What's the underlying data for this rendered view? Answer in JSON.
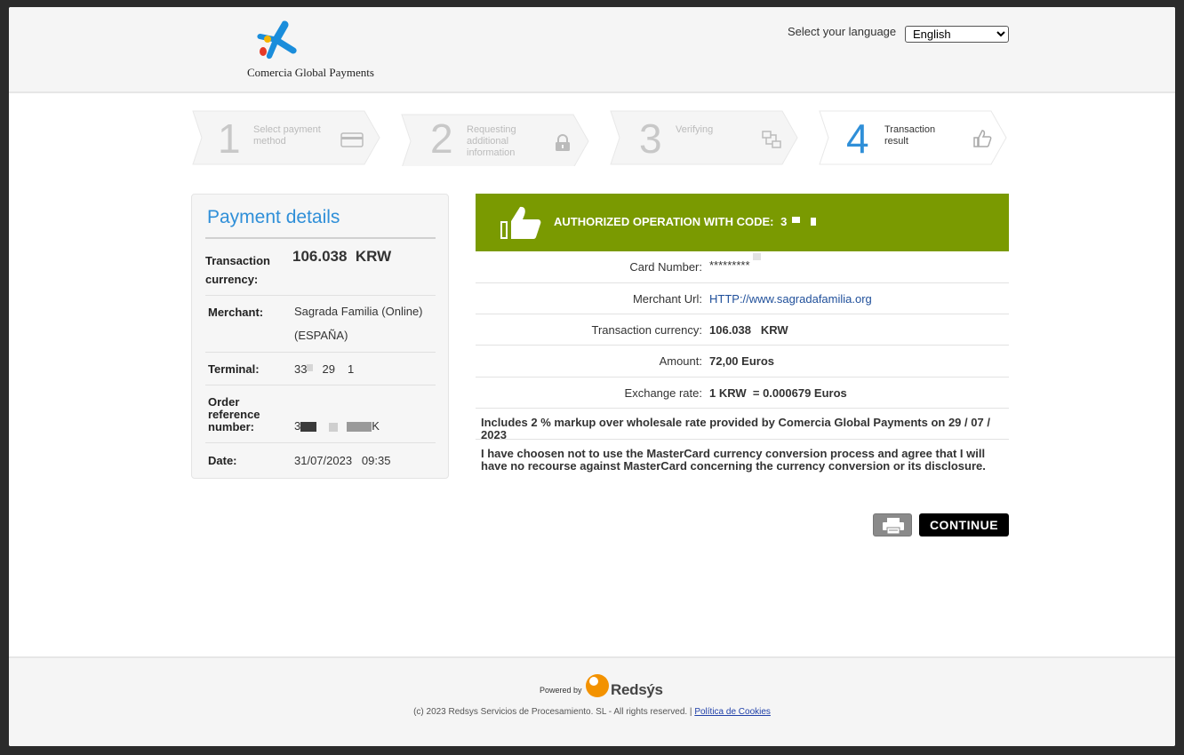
{
  "header": {
    "logo_text": "Comercia Global Payments",
    "language_label": "Select your language",
    "language_selected": "English"
  },
  "steps": [
    {
      "number": "1",
      "label_line1": "Select payment",
      "label_line2": "method",
      "label_line3": "",
      "icon": "credit-card-icon",
      "active": false
    },
    {
      "number": "2",
      "label_line1": "Requesting",
      "label_line2": "additional",
      "label_line3": "information",
      "icon": "lock-icon",
      "active": false
    },
    {
      "number": "3",
      "label_line1": "Verifying",
      "label_line2": "",
      "label_line3": "",
      "icon": "verify-transfer-icon",
      "active": false
    },
    {
      "number": "4",
      "label_line1": "Transaction",
      "label_line2": "result",
      "label_line3": "",
      "icon": "thumbs-up-icon",
      "active": true
    }
  ],
  "payment_details": {
    "title": "Payment details",
    "currency_label_1": "Transaction",
    "currency_label_2": "currency:",
    "currency_value": "106.038  KRW",
    "merchant_label": "Merchant:",
    "merchant_value_1": "Sagrada Familia (Online)",
    "merchant_value_2": "(ESPAÑA)",
    "terminal_label": "Terminal:",
    "terminal_value_a": "33",
    "terminal_value_b": "29",
    "terminal_value_c": "1",
    "order_label_1": "Order",
    "order_label_2": "reference",
    "order_label_3": "number:",
    "order_value_a": "3",
    "order_value_b": "K",
    "date_label": "Date:",
    "date_value": "31/07/2023   09:35"
  },
  "result": {
    "auth_text": "AUTHORIZED OPERATION WITH CODE:",
    "auth_code_visible": "3",
    "rows": [
      {
        "label": "Card Number:",
        "value": "*********",
        "bold": false
      },
      {
        "label": "Merchant Url:",
        "value": "HTTP://www.sagradafamilia.org",
        "bold": false,
        "link": true
      },
      {
        "label": "Transaction currency:",
        "value": "106.038   KRW",
        "bold": true
      },
      {
        "label": "Amount:",
        "value": "72,00 Euros",
        "bold": true
      },
      {
        "label": "Exchange rate:",
        "value": "1 KRW  = 0.000679 Euros",
        "bold": true
      }
    ],
    "markup_note": "Includes 2 % markup over wholesale rate provided by Comercia Global Payments on 29 / 07 / 2023",
    "mastercard_note": "I have choosen not to use the MasterCard currency conversion process and agree that I will have no recourse against MasterCard concerning the currency conversion or its disclosure.",
    "continue_label": "CONTINUE"
  },
  "footer": {
    "powered_by": "Powered by",
    "brand": "Redsýs",
    "copyright": "(c) 2023 Redsys Servicios de Procesamiento. SL - All rights reserved. |",
    "cookies_link": "Política de Cookies"
  },
  "colors": {
    "accent_blue": "#2f8fd8",
    "auth_green": "#7a9a01",
    "redsys_orange": "#f39200"
  }
}
